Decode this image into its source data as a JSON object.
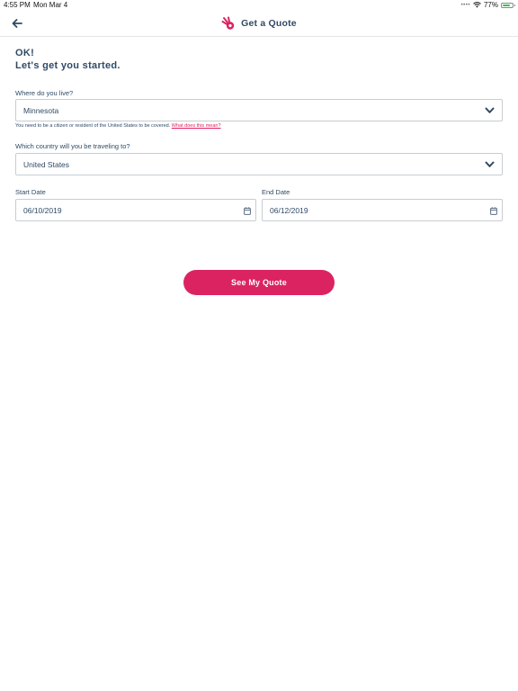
{
  "status_bar": {
    "time": "4:55 PM",
    "date": "Mon Mar 4",
    "battery_percent": "77%",
    "battery_level": 0.77
  },
  "nav": {
    "title": "Get a Quote"
  },
  "form": {
    "heading_line1": "OK!",
    "heading_line2": "Let's get you started.",
    "residence": {
      "label": "Where do you live?",
      "value": "Minnesota",
      "note": "You need to be a citizen or resident of the United States to be covered.",
      "note_link": "What does this mean?"
    },
    "destination": {
      "label": "Which country will you be traveling to?",
      "value": "United States"
    },
    "start_date": {
      "label": "Start Date",
      "value": "06/10/2019"
    },
    "end_date": {
      "label": "End Date",
      "value": "06/12/2019"
    },
    "submit_label": "See My Quote"
  },
  "colors": {
    "primary_text": "#2f4a66",
    "accent": "#dc2361",
    "border": "#c8cdd2"
  }
}
